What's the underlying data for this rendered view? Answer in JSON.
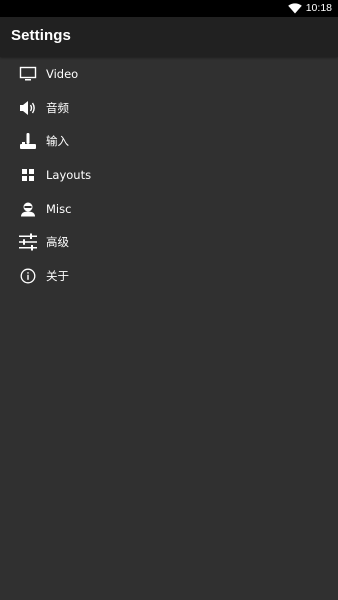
{
  "status_bar": {
    "time": "10:18",
    "wifi_icon": "wifi-icon"
  },
  "app_bar": {
    "title": "Settings"
  },
  "menu": [
    {
      "label": "Video",
      "icon": "monitor-icon"
    },
    {
      "label": "音频",
      "icon": "speaker-icon"
    },
    {
      "label": "输入",
      "icon": "joystick-icon"
    },
    {
      "label": "Layouts",
      "icon": "grid-icon"
    },
    {
      "label": "Misc",
      "icon": "user-icon"
    },
    {
      "label": "高级",
      "icon": "sliders-icon"
    },
    {
      "label": "关于",
      "icon": "info-icon"
    }
  ],
  "colors": {
    "status_bar_bg": "#000000",
    "app_bar_bg": "#212121",
    "background": "#303030",
    "text": "#ffffff"
  }
}
